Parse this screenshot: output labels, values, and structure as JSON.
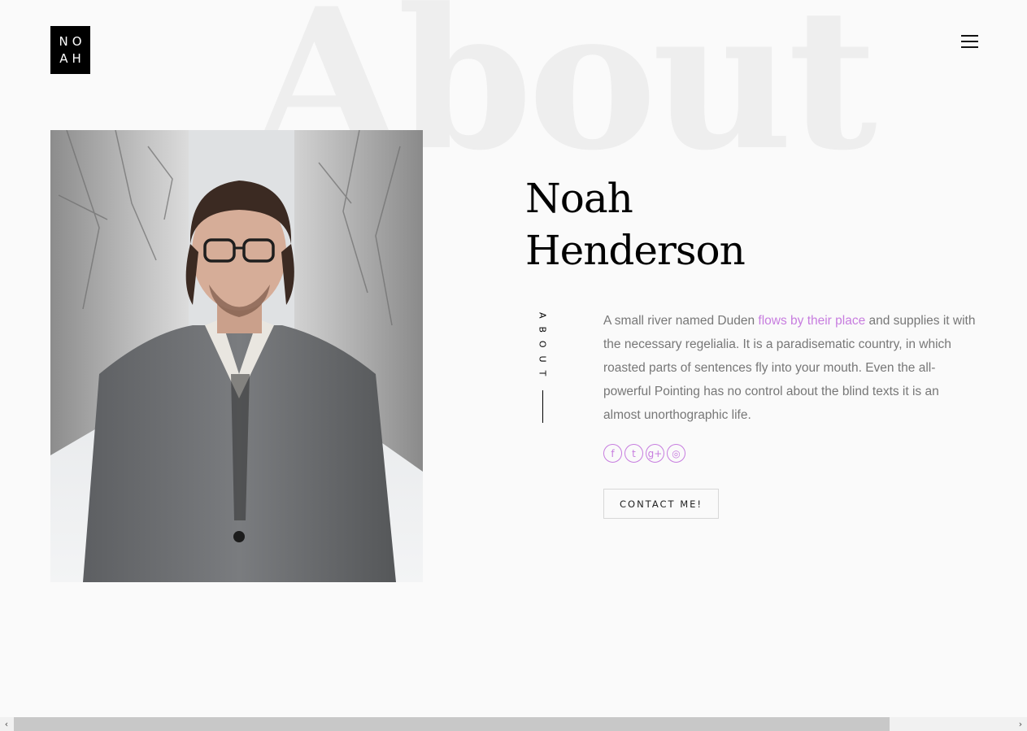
{
  "logo": {
    "line1": "NO",
    "line2": "AH"
  },
  "background_word": "About",
  "profile": {
    "first_name": "Noah",
    "last_name": "Henderson",
    "section_label": "ABOUT",
    "bio_before_link": "A small river named Duden ",
    "bio_link": "flows by their place",
    "bio_after_link": " and supplies it with the necessary regelialia. It is a paradisematic country, in which roasted parts of sentences fly into your mouth. Even the all-powerful Pointing has no control about the blind texts it is an almost unorthographic life."
  },
  "social": [
    {
      "name": "facebook-icon",
      "glyph": "f"
    },
    {
      "name": "twitter-icon",
      "glyph": "t"
    },
    {
      "name": "google-plus-icon",
      "glyph": "g+"
    },
    {
      "name": "dribbble-icon",
      "glyph": "◎"
    }
  ],
  "contact_button": "CONTACT ME!",
  "scrollbar": {
    "left_arrow": "‹",
    "right_arrow": "›"
  },
  "colors": {
    "accent": "#c77ddf",
    "text": "#777777",
    "background": "#fafafa",
    "logo_bg": "#000000"
  }
}
